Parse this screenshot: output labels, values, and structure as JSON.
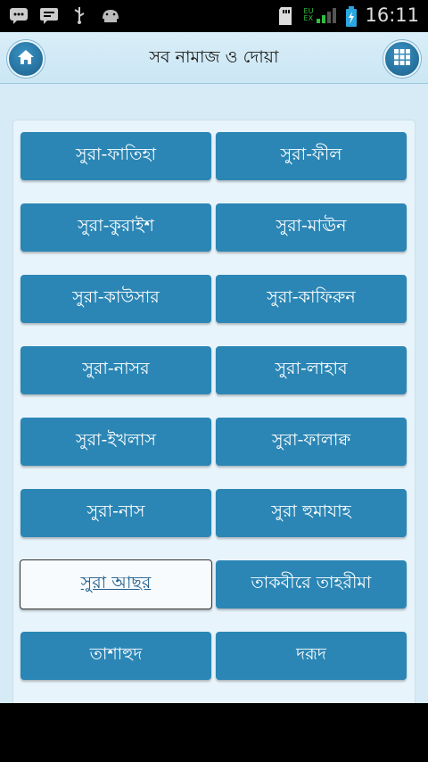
{
  "status_bar": {
    "time": "16:11",
    "network_top": "EU",
    "network_bottom": "EX",
    "icons": [
      "bbm-icon",
      "message-icon",
      "usb-icon",
      "android-icon",
      "sd-card-icon",
      "signal-icon",
      "battery-icon"
    ]
  },
  "header": {
    "title": "সব নামাজ ও দোয়া",
    "home_icon": "home-icon",
    "menu_icon": "grid-menu-icon"
  },
  "buttons": [
    {
      "label": "সুরা-ফাতিহা"
    },
    {
      "label": "সুরা-ফীল"
    },
    {
      "label": "সুরা-কুরাইশ"
    },
    {
      "label": "সুরা-মাঊন"
    },
    {
      "label": "সুরা-কাউসার"
    },
    {
      "label": "সুরা-কাফিরুন"
    },
    {
      "label": "সুরা-নাসর"
    },
    {
      "label": "সুরা-লাহাব"
    },
    {
      "label": "সুরা-ইখলাস"
    },
    {
      "label": "সুরা-ফালাক্ব"
    },
    {
      "label": "সুরা-নাস"
    },
    {
      "label": "সুরা হুমাযাহ"
    },
    {
      "label": "সুরা আছর"
    },
    {
      "label": "তাকবীরে তাহরীমা"
    },
    {
      "label": "তাশাহুদ"
    },
    {
      "label": "দরূদ"
    }
  ],
  "selected_button": "সুরা আছর",
  "colors": {
    "button": "#2b86b5",
    "header_bg": "#d9eef8",
    "content_bg": "#d6ebf6"
  }
}
